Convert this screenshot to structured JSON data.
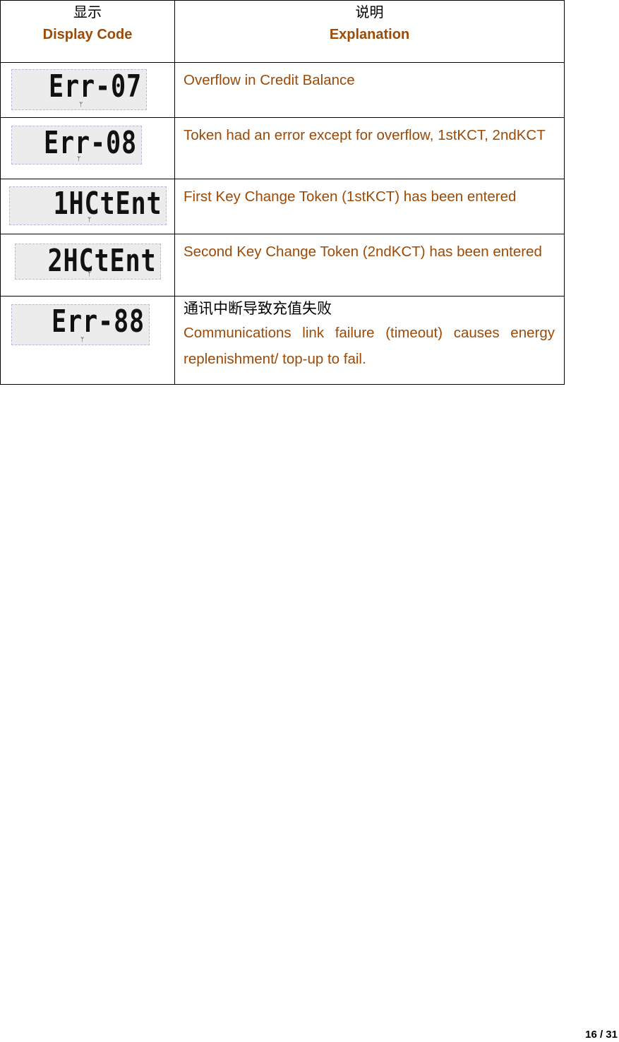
{
  "header": {
    "display_cn": "显示",
    "display_en": "Display Code",
    "explain_cn": "说明",
    "explain_en": "Explanation"
  },
  "rows": [
    {
      "display": "Err-07",
      "explanation": "Overflow in Credit Balance"
    },
    {
      "display": "Err-08",
      "explanation": "Token had an error except for overflow, 1stKCT, 2ndKCT"
    },
    {
      "display": "1HCtEnt",
      "explanation": "First Key Change Token (1stKCT) has been entered"
    },
    {
      "display": "2HCtEnt",
      "explanation": "Second Key Change Token (2ndKCT) has been entered"
    },
    {
      "display": "Err-88",
      "explanation_cn": "通讯中断导致充值失败",
      "explanation": "Communications link failure (timeout) causes energy replenishment/ top-up to fail."
    }
  ],
  "page_number": "16 / 31",
  "colors": {
    "text_accent": "#9C4A06"
  }
}
